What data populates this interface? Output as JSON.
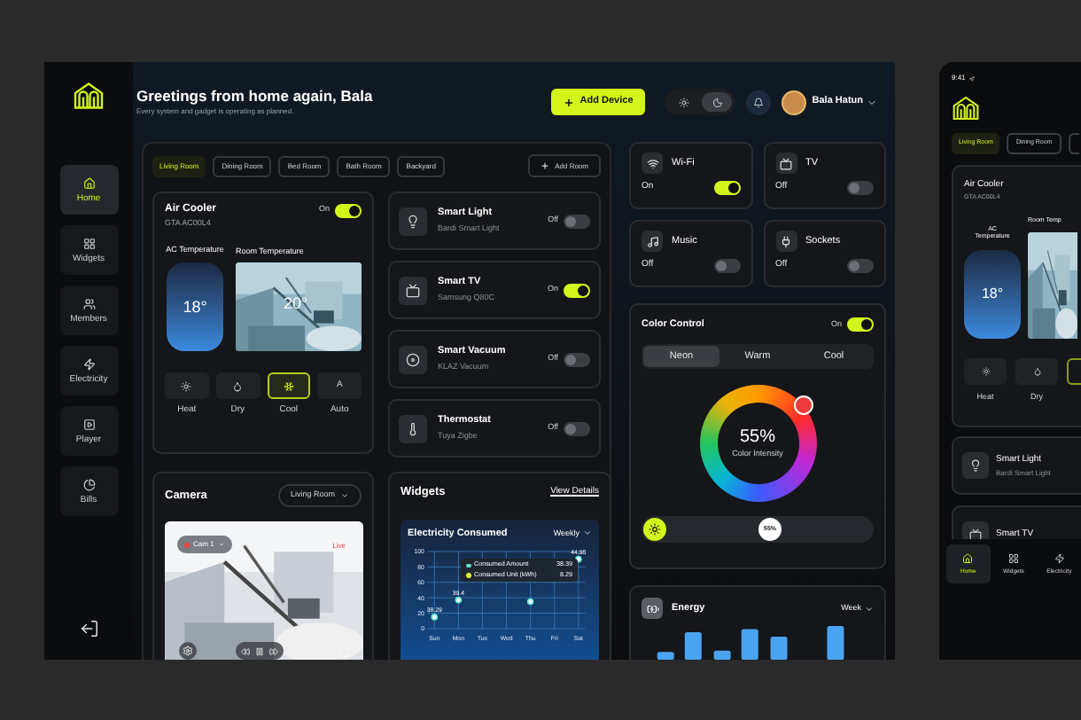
{
  "sidebar": {
    "items": [
      {
        "label": "Home",
        "kind": "home",
        "selected": true
      },
      {
        "label": "Widgets",
        "kind": "grid",
        "selected": false
      },
      {
        "label": "Members",
        "kind": "members",
        "selected": false
      },
      {
        "label": "Electricity",
        "kind": "bolt",
        "selected": false
      },
      {
        "label": "Player",
        "kind": "player",
        "selected": false
      },
      {
        "label": "Bills",
        "kind": "bills",
        "selected": false
      }
    ]
  },
  "header": {
    "title": "Greetings from home again, Bala",
    "subtitle": "Every system and gadget is operating as planned.",
    "add_button": "Add Device",
    "theme_modes": [
      {
        "kind": "light",
        "selected": false
      },
      {
        "kind": "dark",
        "selected": true
      }
    ],
    "user": "Bala Hatun"
  },
  "rooms": {
    "tabs": [
      {
        "label": "Living Room",
        "selected": true
      },
      {
        "label": "Dining Room",
        "selected": false
      },
      {
        "label": "Bed Room",
        "selected": false
      },
      {
        "label": "Bath Room",
        "selected": false
      },
      {
        "label": "Backyard",
        "selected": false
      }
    ],
    "add_button": "Add Room"
  },
  "air_cooler": {
    "name": "Air Cooler",
    "model": "GTA AC00L4",
    "state_label": "On",
    "on": true,
    "ac_label": "AC Temperature",
    "ac_temp": "18°",
    "room_label": "Room Temperature",
    "room_temp": "20°",
    "modes": [
      {
        "label": "Heat",
        "kind": "sun",
        "selected": false
      },
      {
        "label": "Dry",
        "kind": "drop",
        "selected": false
      },
      {
        "label": "Cool",
        "kind": "snow",
        "selected": true
      },
      {
        "label": "Auto",
        "kind": "letter",
        "icon": "A",
        "selected": false
      }
    ]
  },
  "devices": [
    {
      "name": "Smart Light",
      "model": "Bardi Smart Light",
      "state_label": "Off",
      "on": false,
      "kind": "bulb"
    },
    {
      "name": "Smart TV",
      "model": "Samsung Q80C",
      "state_label": "On",
      "on": true,
      "kind": "tv"
    },
    {
      "name": "Smart Vacuum",
      "model": "KLAZ Vacuum",
      "state_label": "Off",
      "on": false,
      "kind": "vacuum"
    },
    {
      "name": "Thermostat",
      "model": "Tuya Zigbe",
      "state_label": "Off",
      "on": false,
      "kind": "thermo"
    }
  ],
  "camera": {
    "title": "Camera",
    "room": "Living Room",
    "cam": "Cam 1",
    "live": "Live"
  },
  "widgets": {
    "title": "Widgets",
    "link": "View Details",
    "chart_title": "Electricity Consumed",
    "period": "Weekly",
    "tooltip": [
      {
        "label": "Consumed Amount",
        "value": "38.39",
        "color": "#5eead4"
      },
      {
        "label": "Consumed Unit (kWh)",
        "value": "8.29",
        "color": "#e5f53a"
      }
    ],
    "chart_data": {
      "type": "scatter",
      "categories": [
        "Sun",
        "Mon",
        "Tue",
        "Wed",
        "Thu",
        "Fri",
        "Sat"
      ],
      "values": [
        15,
        37,
        null,
        null,
        35,
        null,
        90
      ],
      "ylim": [
        0,
        100
      ],
      "yticks": [
        0,
        20,
        40,
        60,
        80,
        100
      ],
      "grid": true,
      "annotations": [
        {
          "x": "Sun",
          "y": 15,
          "text": "38.29"
        },
        {
          "x": "Mon",
          "y": 37,
          "text": "39.4"
        },
        {
          "x": "Sat",
          "y": 90,
          "text": "44.90"
        }
      ]
    }
  },
  "quick": [
    {
      "name": "Wi-Fi",
      "state_label": "On",
      "on": true,
      "kind": "wifi"
    },
    {
      "name": "TV",
      "state_label": "Off",
      "on": false,
      "kind": "tv"
    },
    {
      "name": "Music",
      "state_label": "Off",
      "on": false,
      "kind": "music"
    },
    {
      "name": "Sockets",
      "state_label": "Off",
      "on": false,
      "kind": "plug"
    }
  ],
  "color_control": {
    "title": "Color Control",
    "state_label": "On",
    "on": true,
    "modes": [
      {
        "label": "Neon",
        "selected": true
      },
      {
        "label": "Warm",
        "selected": false
      },
      {
        "label": "Cool",
        "selected": false
      }
    ],
    "value": "55%",
    "caption": "Color Intensity",
    "level": 0.55,
    "slider_label": "55%"
  },
  "energy": {
    "title": "Energy",
    "period": "Week"
  },
  "phone": {
    "time": "9:41",
    "tabs": [
      {
        "label": "Living Room",
        "selected": true
      },
      {
        "label": "Dining Room",
        "selected": false
      }
    ],
    "card_name": "Air Cooler",
    "card_model": "GTA AC00L4",
    "ac_label": "AC Temperature",
    "room_label": "Room Temp",
    "ac_temp": "18°",
    "modes": [
      {
        "label": "Heat",
        "kind": "sun"
      },
      {
        "label": "Dry",
        "kind": "drop"
      }
    ],
    "devices": [
      {
        "name": "Smart Light",
        "model": "Bardi Smart Light",
        "kind": "bulb"
      },
      {
        "name": "Smart TV",
        "kind": "tv"
      }
    ],
    "nav": [
      {
        "label": "Home",
        "kind": "home",
        "selected": true
      },
      {
        "label": "Widgets",
        "kind": "grid",
        "selected": false
      },
      {
        "label": "Electricity",
        "kind": "bolt",
        "selected": false
      }
    ]
  }
}
